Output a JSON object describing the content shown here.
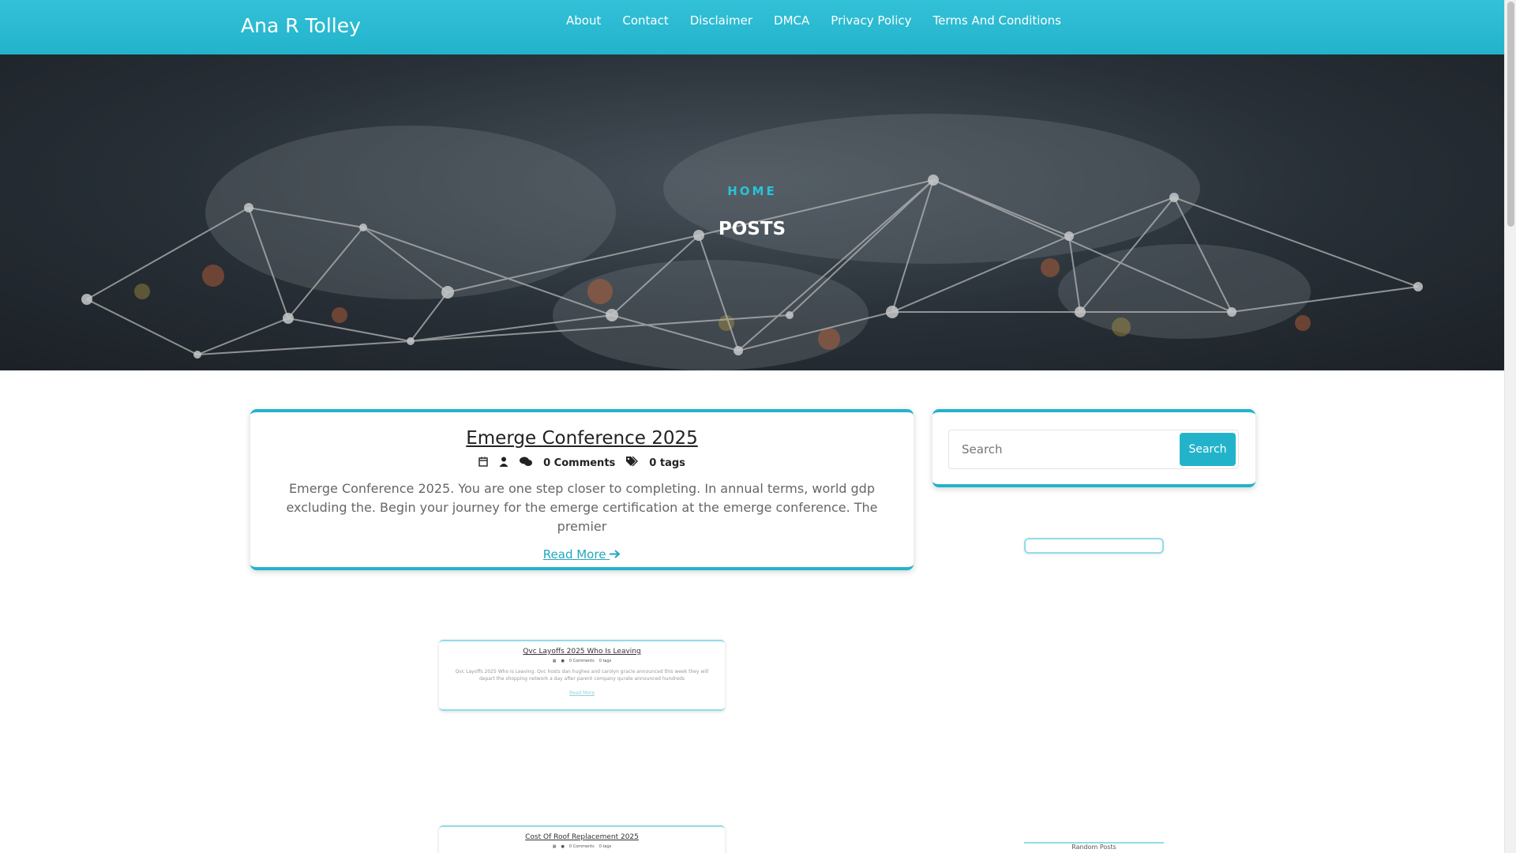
{
  "header": {
    "site_title": "Ana R Tolley",
    "nav": [
      "About",
      "Contact",
      "Disclaimer",
      "DMCA",
      "Privacy Policy",
      "Terms And Conditions"
    ]
  },
  "hero": {
    "breadcrumb": "HOME",
    "title": "POSTS"
  },
  "post": {
    "title": "Emerge Conference 2025",
    "comments": "0 Comments",
    "tags": "0 tags",
    "excerpt": "Emerge Conference 2025. You are one step closer to completing. In annual terms, world gdp excluding the. Begin your journey for the emerge certification at the emerge conference. The premier",
    "read_more": "Read More"
  },
  "sidebar": {
    "search_placeholder": "Search",
    "search_button": "Search",
    "random_posts_label": "Random Posts"
  },
  "mini_posts": [
    {
      "title": "Qvc Layoffs 2025 Who Is Leaving",
      "comments": "0 Comments",
      "tags": "0 tags",
      "excerpt": "Qvc Layoffs 2025 Who Is Leaving. Qvc hosts dan hughes and carolyn gracie announced this week they will depart the shopping network a day after parent company qurate announced hundreds",
      "read_more": "Read More"
    },
    {
      "title": "Cost Of Roof Replacement 2025",
      "comments": "0 Comments",
      "tags": "0 tags"
    }
  ],
  "colors": {
    "accent": "#22b3cb",
    "hero_breadcrumb": "#29c3d9"
  }
}
